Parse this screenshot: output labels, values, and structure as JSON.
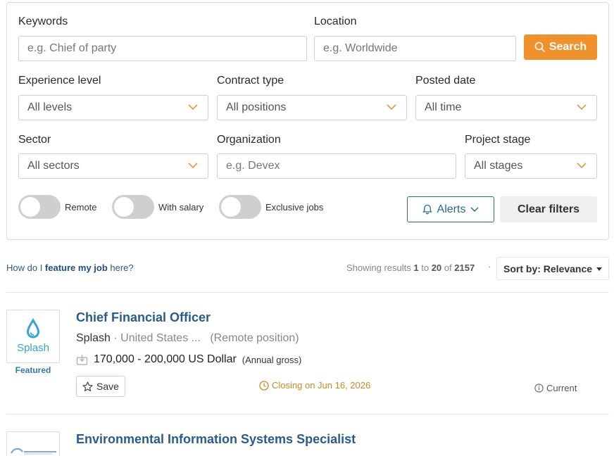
{
  "filters": {
    "keywords": {
      "label": "Keywords",
      "placeholder": "e.g. Chief of party"
    },
    "location": {
      "label": "Location",
      "placeholder": "e.g. Worldwide"
    },
    "search_label": "Search",
    "experience": {
      "label": "Experience level",
      "value": "All levels"
    },
    "contract": {
      "label": "Contract type",
      "value": "All positions"
    },
    "posted": {
      "label": "Posted date",
      "value": "All time"
    },
    "sector": {
      "label": "Sector",
      "value": "All sectors"
    },
    "organization": {
      "label": "Organization",
      "placeholder": "e.g. Devex"
    },
    "stage": {
      "label": "Project stage",
      "value": "All stages"
    },
    "toggles": {
      "remote": "Remote",
      "salary": "With salary",
      "exclusive": "Exclusive jobs"
    },
    "alerts_label": "Alerts",
    "clear_label": "Clear filters"
  },
  "results_bar": {
    "feature_pre": "How do I ",
    "feature_bold": "feature my job",
    "feature_post": " here?",
    "showing": "Showing results ",
    "from": "1",
    "to_word": " to ",
    "to": "20",
    "of_word": " of ",
    "total": "2157",
    "sort_label": "Sort by: Relevance"
  },
  "jobs": [
    {
      "title": "Chief Financial Officer",
      "org": "Splash",
      "location": " · United States ...",
      "remote": "(Remote position)",
      "salary": "170,000 - 200,000 US Dollar",
      "salary_note": "(Annual gross)",
      "save_label": "Save",
      "closing": "Closing on Jun 16, 2026",
      "status": "Current",
      "featured": "Featured",
      "logo_text": "Splash"
    },
    {
      "title": "Environmental Information Systems Specialist"
    }
  ],
  "colors": {
    "accent": "#f0912c",
    "link": "#2b5a8c",
    "closing": "#d3861e"
  }
}
